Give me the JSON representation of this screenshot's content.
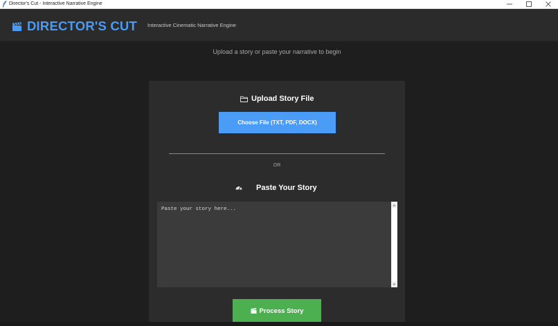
{
  "window": {
    "title": "Director's Cut - Interactive Narrative Engine",
    "controls": {
      "minimize": "—",
      "maximize": "☐",
      "close": "✕"
    }
  },
  "header": {
    "icon": "clapperboard-icon",
    "brand": "DIRECTOR'S CUT",
    "tagline": "Interactive Cinematic Narrative Engine",
    "brand_color": "#4b9bf5"
  },
  "main": {
    "subtitle": "Upload a story or paste your narrative to begin",
    "upload": {
      "icon": "folder-icon",
      "heading": "Upload Story File",
      "button_label": "Choose File (TXT, PDF, DOCX)",
      "button_color": "#4a9cf6"
    },
    "separator_label": "OR",
    "paste": {
      "icon": "meter-icon",
      "heading": "Paste Your Story",
      "placeholder": "Paste your story here...",
      "value": ""
    },
    "process": {
      "icon": "clapperboard-icon",
      "button_label": "Process Story",
      "button_color": "#4caf50"
    }
  }
}
